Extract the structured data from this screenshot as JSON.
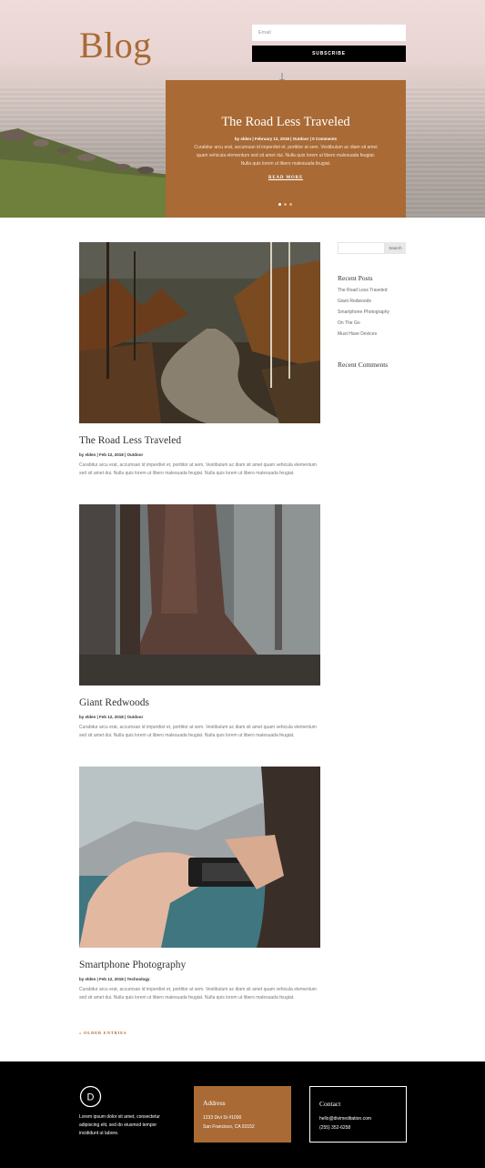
{
  "hero": {
    "title": "Blog",
    "email_placeholder": "Email",
    "subscribe_label": "SUBSCRIBE"
  },
  "slider": {
    "title": "The Road Less Traveled",
    "meta": "by elden | February 12, 2018 | Outdoor | 0 Comments",
    "excerpt": "Curabitur arcu erat, accumsan id imperdiet et, porttitor at sem. Vestibulum ac diam sit amet quam vehicula elementum sed sit amet dui. Nulla quis lorem ut libero malesuada feugiat. Nulla quis lorem ut libero malesuada feugiat.",
    "read_more": "READ MORE",
    "slide_count": 3,
    "active_slide": 1
  },
  "posts": [
    {
      "title": "The Road Less Traveled",
      "meta": "by elden | Feb 12, 2018 | Outdoor",
      "excerpt": "Curabitur arcu erat, accumsan id imperdiet et, porttitor at sem. Vestibulum ac diam sit amet quam vehicula elementum sed sit amet dui. Nulla quis lorem ut libero malesuada feugiat. Nulla quis lorem ut libero malesuada feugiat."
    },
    {
      "title": "Giant Redwoods",
      "meta": "by elden | Feb 12, 2018 | Outdoor",
      "excerpt": "Curabitur arcu erat, accumsan id imperdiet et, porttitor at sem. Vestibulum ac diam sit amet quam vehicula elementum sed sit amet dui. Nulla quis lorem ut libero malesuada feugiat. Nulla quis lorem ut libero malesuada feugiat."
    },
    {
      "title": "Smartphone Photography",
      "meta": "by elden | Feb 12, 2018 | Technology",
      "excerpt": "Curabitur arcu erat, accumsan id imperdiet et, porttitor at sem. Vestibulum ac diam sit amet quam vehicula elementum sed sit amet dui. Nulla quis lorem ut libero malesuada feugiat. Nulla quis lorem ut libero malesuada feugiat."
    }
  ],
  "older_entries": "« OLDER ENTRIES",
  "sidebar": {
    "search_button": "Search",
    "recent_posts_title": "Recent Posts",
    "recent_posts": [
      "The Road Less Traveled",
      "Giant Redwoods",
      "Smartphone Photography",
      "On The Go",
      "Must Have Devices"
    ],
    "recent_comments_title": "Recent Comments"
  },
  "footer": {
    "logo_letter": "D",
    "about": "Lorem ipsum dolor sit amet, consectetur adipiscing elit, sed do eiusmod tempor incididunt ut labore.",
    "address_title": "Address",
    "address_line1": "1233 Divi St #1000",
    "address_line2": "San Francisco, CA 93152",
    "contact_title": "Contact",
    "contact_email": "hello@divimeditation.com",
    "contact_phone": "(255) 352-6258"
  },
  "colors": {
    "accent": "#a96a35",
    "footer_bg": "#000000"
  }
}
